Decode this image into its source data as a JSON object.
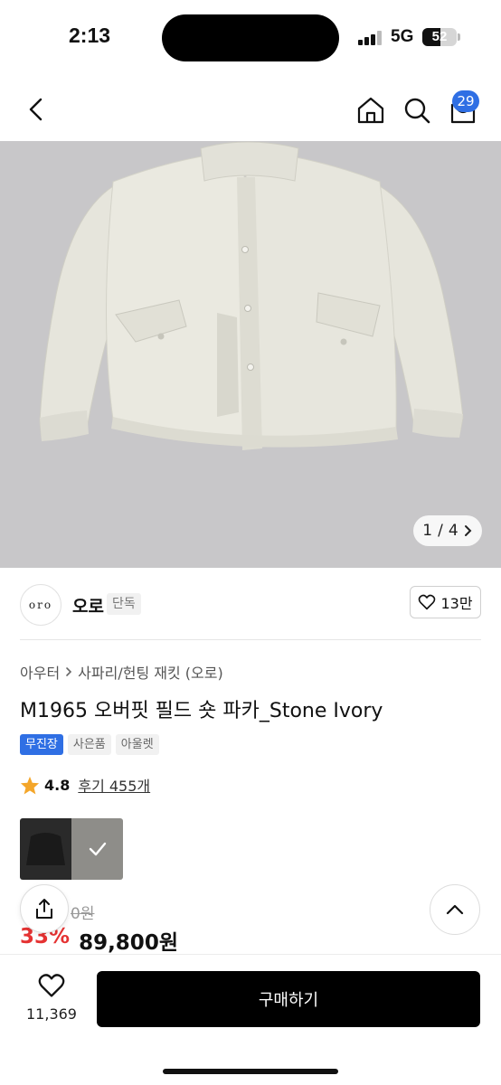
{
  "status_bar": {
    "time": "2:13",
    "network": "5G",
    "battery": "52",
    "battery_level": 0.52
  },
  "header": {
    "cart_count": "29",
    "icons": [
      "back-chevron-icon",
      "home-icon",
      "search-icon",
      "shopping-bag-icon"
    ]
  },
  "gallery": {
    "current": "1",
    "separator": "/",
    "total": "4"
  },
  "brand": {
    "logo_text": "oro",
    "name": "오로",
    "tag": "단독",
    "like_count": "13만"
  },
  "product": {
    "breadcrumb": [
      "아우터",
      "사파리/헌팅 재킷 (오로)"
    ],
    "title": "M1965 오버핏 필드 숏 파카_Stone Ivory",
    "badges": [
      "무진장",
      "사은품",
      "아울렛"
    ],
    "rating": "4.8",
    "reviews": "후기 455개",
    "swatch_colors": [
      "#2a2a2a",
      "#8e8d89"
    ],
    "original_price": "0원",
    "discount": "33%",
    "price": "89,800원"
  },
  "bottom_bar": {
    "wish_count": "11,369",
    "buy_label": "구매하기"
  },
  "colors": {
    "accent": "#2f6fe4",
    "discount": "#e53232",
    "buy_button": "#000000"
  }
}
